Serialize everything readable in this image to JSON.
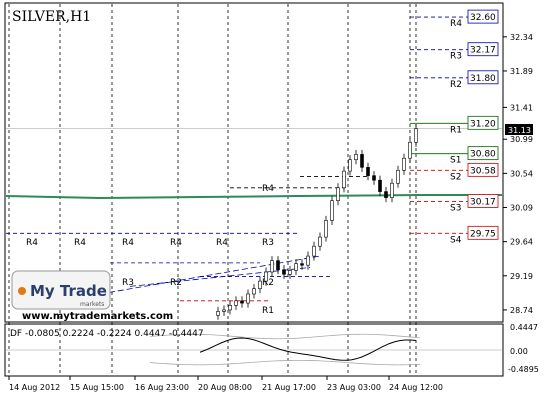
{
  "chart_data": {
    "type": "candlestick",
    "title": "SILVER,H1",
    "ylim": [
      28.66,
      32.72
    ],
    "y_ticks": [
      "32.34",
      "31.89",
      "31.41",
      "30.99",
      "30.54",
      "30.09",
      "29.64",
      "29.19",
      "28.74"
    ],
    "current_price": "31.13",
    "x_ticks": [
      "14 Aug 2012",
      "15 Aug 15:00",
      "16 Aug 23:00",
      "20 Aug 08:00",
      "21 Aug 17:00",
      "23 Aug 03:00",
      "24 Aug 12:00"
    ],
    "boxed_levels": [
      {
        "label": "R4",
        "value": "32.60",
        "y": 32.6
      },
      {
        "label": "R3",
        "value": "32.17",
        "y": 32.17
      },
      {
        "label": "R2",
        "value": "31.80",
        "y": 31.8
      },
      {
        "label": "R1",
        "value": "31.20",
        "y": 31.2
      },
      {
        "label": "S1",
        "value": "30.80",
        "y": 30.8
      },
      {
        "label": "S2",
        "value": "30.58",
        "y": 30.58
      },
      {
        "label": "S3",
        "value": "30.17",
        "y": 30.17
      },
      {
        "label": "S4",
        "value": "29.75",
        "y": 29.75
      }
    ],
    "closes": [
      28.72,
      28.74,
      28.8,
      28.86,
      28.83,
      28.95,
      29.02,
      29.12,
      29.24,
      29.39,
      29.27,
      29.21,
      29.26,
      29.35,
      29.33,
      29.45,
      29.58,
      29.7,
      29.92,
      30.18,
      30.35,
      30.57,
      30.72,
      30.79,
      30.62,
      30.51,
      30.45,
      30.3,
      30.22,
      30.41,
      30.58,
      30.74,
      30.95,
      31.13
    ],
    "historical_labels": [
      "R4",
      "R4",
      "R4",
      "R4",
      "R4",
      "R4",
      "R3",
      "R3",
      "R2",
      "R2",
      "R1"
    ],
    "indicator": {
      "label": "DF -0.0805 0.2224 -0.2224 0.4447 -0.4447",
      "y_ticks": [
        "0.4447",
        "0.00",
        "-0.4895"
      ]
    },
    "watermark": {
      "brand": "My Trade",
      "sub": "markets",
      "url": "www.mytrademarkets.com"
    },
    "colors": {
      "up": "#ffffff",
      "down": "#000000",
      "green_level": "#006400",
      "red_level": "#cc0000",
      "blue_level": "#0000aa",
      "main_line": "#2e8b57"
    }
  }
}
